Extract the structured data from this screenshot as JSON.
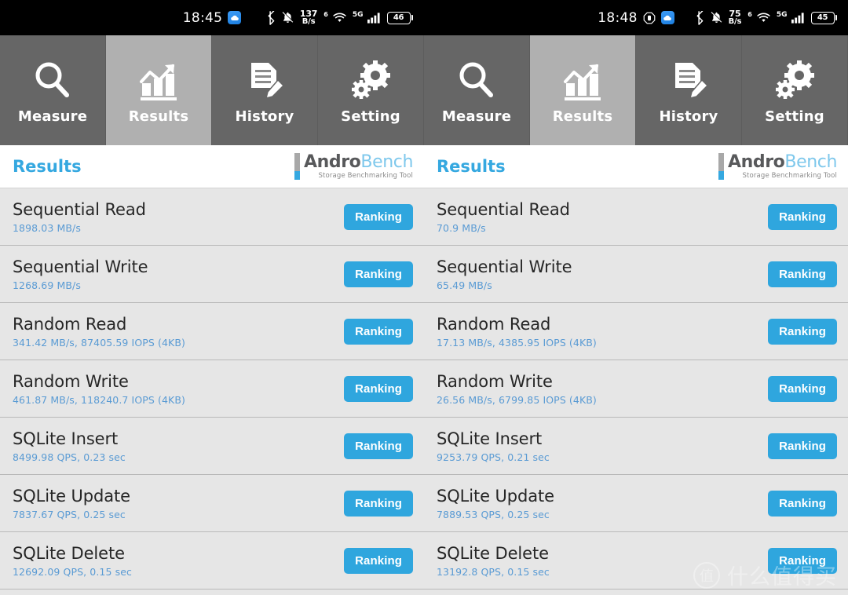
{
  "colors": {
    "accent": "#35a8e0",
    "button": "#2fa6de",
    "tab_inactive": "#666666",
    "tab_active": "#b0b0b0",
    "list_bg": "#e6e6e6",
    "subtext": "#5a9bd4"
  },
  "panels": [
    {
      "statusbar": {
        "time": "18:45",
        "center_icons": [
          "cloud-icon"
        ],
        "net_speed_value": "137",
        "net_speed_unit": "B/s",
        "wifi_generation": "6",
        "network_type": "5G",
        "battery_level": "46",
        "right_icons": [
          "bluetooth-icon",
          "bell-muted-icon",
          "net-speed",
          "wifi-icon",
          "signal-icon",
          "battery-icon"
        ]
      },
      "tabs": [
        {
          "label": "Measure",
          "icon": "magnifier-icon",
          "active": false
        },
        {
          "label": "Results",
          "icon": "bar-chart-icon",
          "active": true
        },
        {
          "label": "History",
          "icon": "document-pencil-icon",
          "active": false
        },
        {
          "label": "Setting",
          "icon": "gears-icon",
          "active": false
        }
      ],
      "header": {
        "title": "Results",
        "logo_main_1": "Andro",
        "logo_main_2": "Bench",
        "logo_sub": "Storage Benchmarking Tool"
      },
      "results": [
        {
          "title": "Sequential Read",
          "detail": "1898.03 MB/s",
          "button": "Ranking"
        },
        {
          "title": "Sequential Write",
          "detail": "1268.69 MB/s",
          "button": "Ranking"
        },
        {
          "title": "Random Read",
          "detail": "341.42 MB/s, 87405.59 IOPS (4KB)",
          "button": "Ranking"
        },
        {
          "title": "Random Write",
          "detail": "461.87 MB/s, 118240.7 IOPS (4KB)",
          "button": "Ranking"
        },
        {
          "title": "SQLite Insert",
          "detail": "8499.98 QPS, 0.23 sec",
          "button": "Ranking"
        },
        {
          "title": "SQLite Update",
          "detail": "7837.67 QPS, 0.25 sec",
          "button": "Ranking"
        },
        {
          "title": "SQLite Delete",
          "detail": "12692.09 QPS, 0.15 sec",
          "button": "Ranking"
        }
      ]
    },
    {
      "statusbar": {
        "time": "18:48",
        "center_icons": [
          "octagon-icon",
          "cloud-icon"
        ],
        "net_speed_value": "75",
        "net_speed_unit": "B/s",
        "wifi_generation": "6",
        "network_type": "5G",
        "battery_level": "45",
        "right_icons": [
          "bluetooth-icon",
          "bell-muted-icon",
          "net-speed",
          "wifi-icon",
          "signal-icon",
          "battery-icon"
        ]
      },
      "tabs": [
        {
          "label": "Measure",
          "icon": "magnifier-icon",
          "active": false
        },
        {
          "label": "Results",
          "icon": "bar-chart-icon",
          "active": true
        },
        {
          "label": "History",
          "icon": "document-pencil-icon",
          "active": false
        },
        {
          "label": "Setting",
          "icon": "gears-icon",
          "active": false
        }
      ],
      "header": {
        "title": "Results",
        "logo_main_1": "Andro",
        "logo_main_2": "Bench",
        "logo_sub": "Storage Benchmarking Tool"
      },
      "results": [
        {
          "title": "Sequential Read",
          "detail": "70.9 MB/s",
          "button": "Ranking"
        },
        {
          "title": "Sequential Write",
          "detail": "65.49 MB/s",
          "button": "Ranking"
        },
        {
          "title": "Random Read",
          "detail": "17.13 MB/s, 4385.95 IOPS (4KB)",
          "button": "Ranking"
        },
        {
          "title": "Random Write",
          "detail": "26.56 MB/s, 6799.85 IOPS (4KB)",
          "button": "Ranking"
        },
        {
          "title": "SQLite Insert",
          "detail": "9253.79 QPS, 0.21 sec",
          "button": "Ranking"
        },
        {
          "title": "SQLite Update",
          "detail": "7889.53 QPS, 0.25 sec",
          "button": "Ranking"
        },
        {
          "title": "SQLite Delete",
          "detail": "13192.8 QPS, 0.15 sec",
          "button": "Ranking"
        }
      ]
    }
  ],
  "watermark": {
    "mark": "值",
    "text": "什么值得买"
  }
}
